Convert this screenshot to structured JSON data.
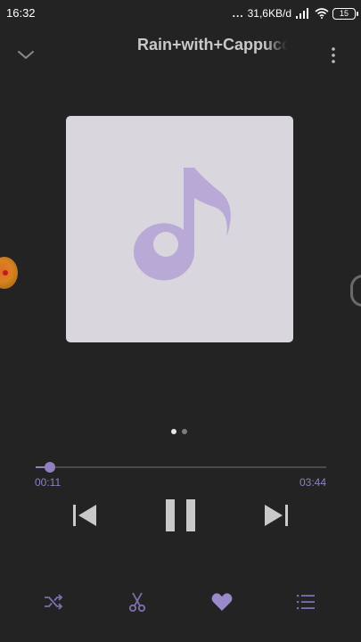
{
  "status_bar": {
    "time": "16:32",
    "dots": "...",
    "network_speed": "31,6KB/d",
    "battery_level": "15"
  },
  "header": {
    "title": "Rain+with+Cappuccino",
    "collapse_icon": "chevron-down-icon",
    "more_icon": "more-vertical-icon"
  },
  "artwork": {
    "placeholder_icon": "music-note-icon"
  },
  "pager": {
    "pages": 2,
    "active_page": 1
  },
  "player": {
    "elapsed": "00:11",
    "total": "03:44",
    "progress": 0.049
  },
  "controls": {
    "previous_icon": "skip-previous-icon",
    "pause_icon": "pause-icon",
    "next_icon": "skip-next-icon"
  },
  "bottom_bar": {
    "shuffle_icon": "shuffle-icon",
    "cut_icon": "scissors-icon",
    "favorite_icon": "heart-icon",
    "queue_icon": "playlist-icon"
  },
  "colors": {
    "background": "#232323",
    "accent": "#8f80c0",
    "artwork_bg": "#d9d6de",
    "note": "#b8a9d6"
  }
}
